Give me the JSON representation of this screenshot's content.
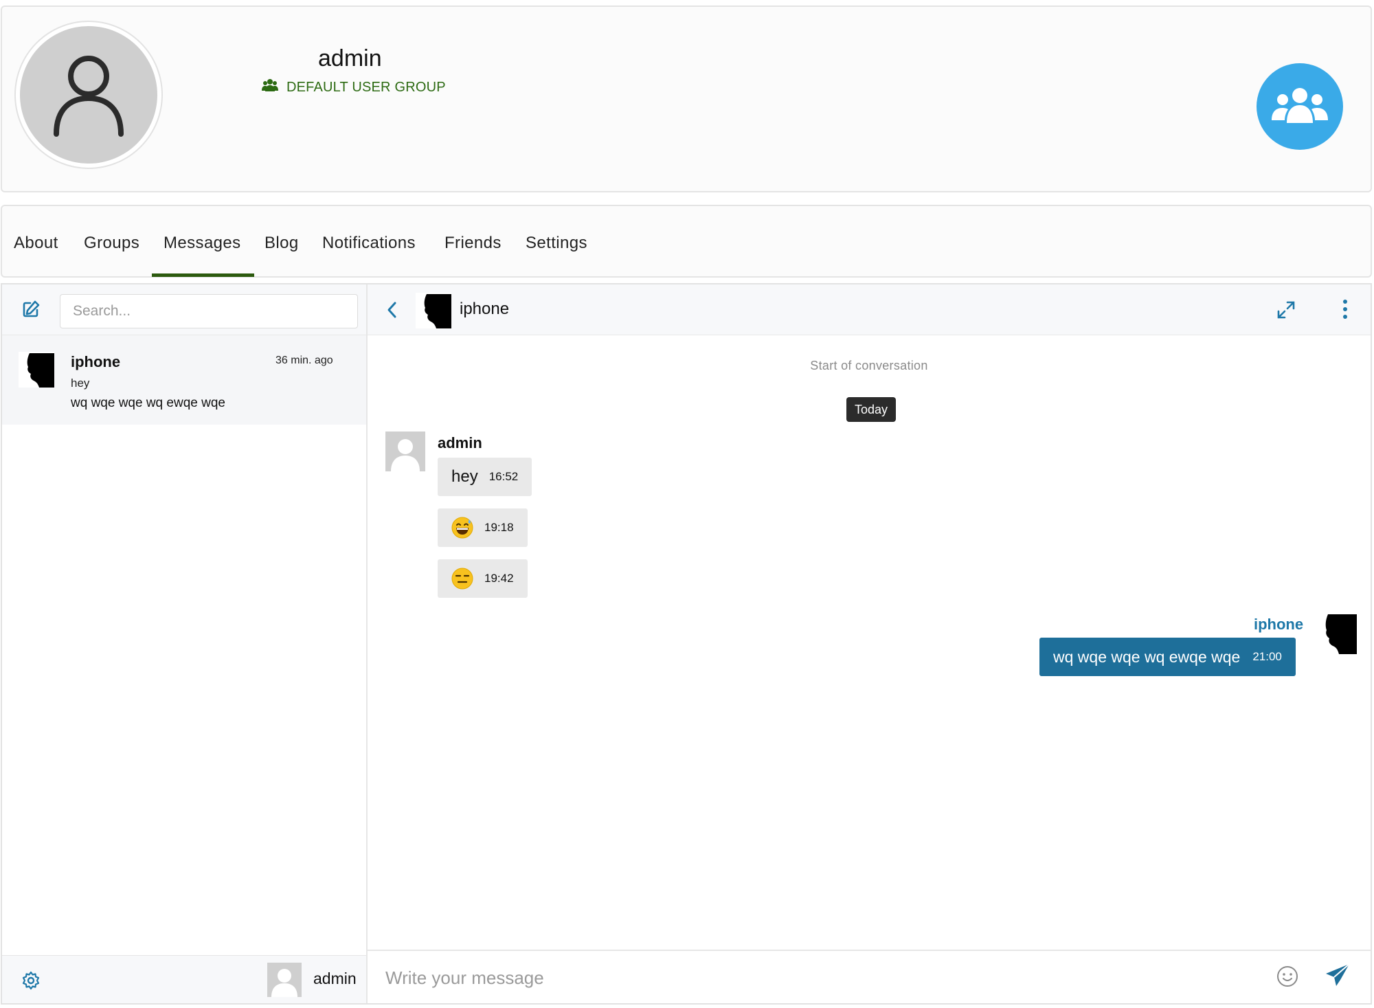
{
  "profile": {
    "name": "admin",
    "group_label": "DEFAULT USER GROUP",
    "group_icon": "users-icon",
    "groups_button_icon": "group-icon",
    "accent_color": "#3aaae8",
    "group_color": "#2c6a12"
  },
  "tabs": [
    {
      "label": "About"
    },
    {
      "label": "Groups"
    },
    {
      "label": "Messages",
      "active": true
    },
    {
      "label": "Blog"
    },
    {
      "label": "Notifications"
    },
    {
      "label": "Friends"
    },
    {
      "label": "Settings"
    }
  ],
  "sidebar": {
    "compose_icon": "compose-icon",
    "search_placeholder": "Search...",
    "conversations": [
      {
        "name": "iphone",
        "time": "36 min. ago",
        "preview_line1": "hey",
        "preview_line2": "wq wqe wqe wq ewqe wqe"
      }
    ],
    "footer": {
      "settings_icon": "gear-icon",
      "user_name": "admin"
    }
  },
  "chat": {
    "title": "iphone",
    "start_label": "Start of conversation",
    "date_chip": "Today",
    "incoming": {
      "sender": "admin",
      "messages": [
        {
          "text": "hey",
          "time": "16:52"
        },
        {
          "emoji": "grinning-sweat-emoji",
          "time": "19:18"
        },
        {
          "emoji": "expressionless-emoji",
          "time": "19:42"
        }
      ]
    },
    "outgoing": {
      "sender": "iphone",
      "messages": [
        {
          "text": "wq wqe wqe wq ewqe wqe",
          "time": "21:00"
        }
      ]
    },
    "composer_placeholder": "Write your message",
    "outgoing_color": "#1e6f9a",
    "sender_color": "#1e78a8"
  }
}
